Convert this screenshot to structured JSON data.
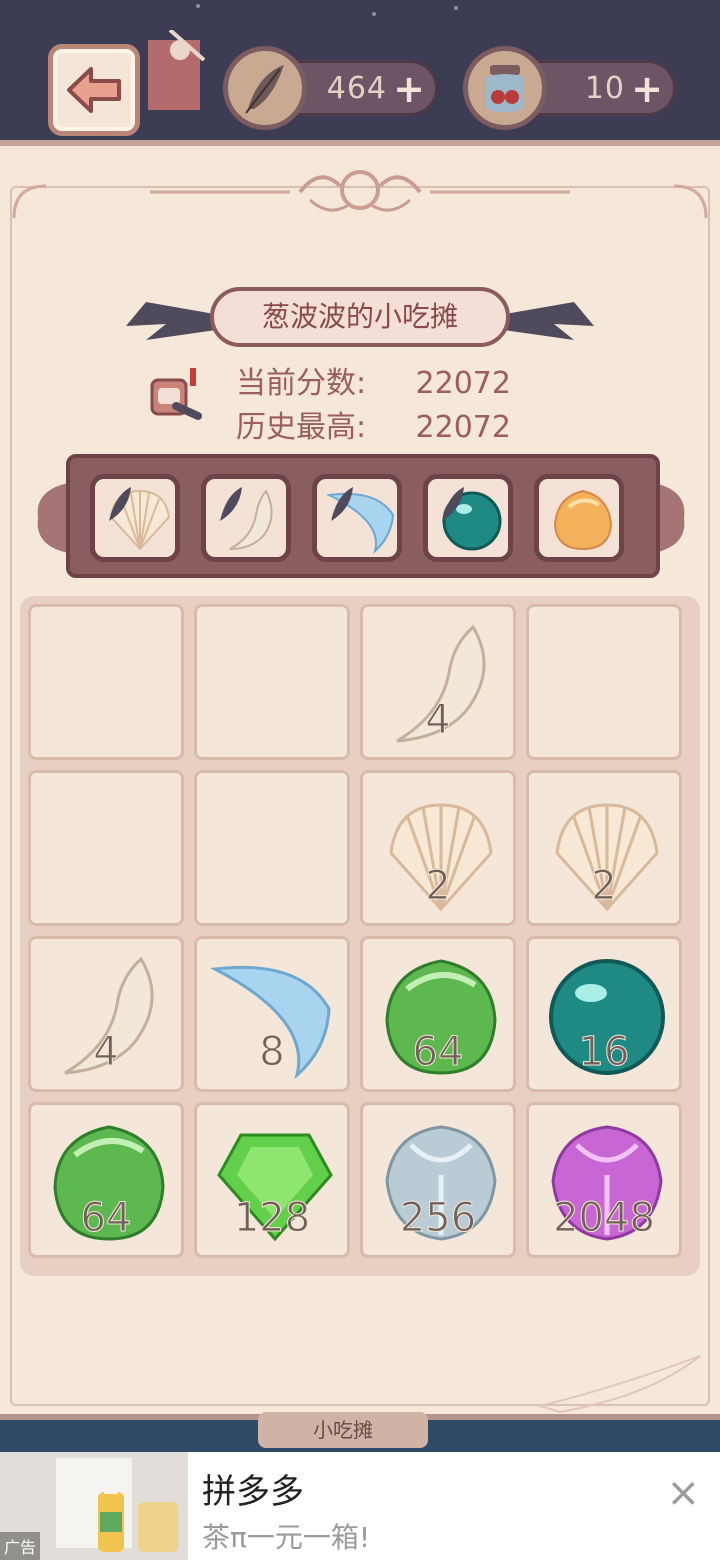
{
  "resources": {
    "feather_value": "464",
    "jar_value": "10",
    "plus_label": "+"
  },
  "stall": {
    "title": "葱波波的小吃摊",
    "current_score_label": "当前分数:",
    "current_score": "22072",
    "best_score_label": "历史最高:",
    "best_score": "22072"
  },
  "preview_items": [
    {
      "kind": "shell"
    },
    {
      "kind": "fang"
    },
    {
      "kind": "blue-crescent"
    },
    {
      "kind": "teal-orb"
    },
    {
      "kind": "orange-drop"
    }
  ],
  "board": {
    "rows": [
      [
        null,
        null,
        "4",
        null
      ],
      [
        null,
        null,
        "2",
        "2"
      ],
      [
        "4",
        "8",
        "64",
        "16"
      ],
      [
        "64",
        "128",
        "256",
        "2048"
      ]
    ]
  },
  "bottom_nav": {
    "label": "小吃摊"
  },
  "ad": {
    "tag": "广告",
    "title": "拼多多",
    "subtitle": "茶π一元一箱!",
    "close": "×"
  },
  "colors": {
    "parchment": "#f6e8d8",
    "frame": "#8a5d61",
    "text_score": "#9b5e5b"
  }
}
